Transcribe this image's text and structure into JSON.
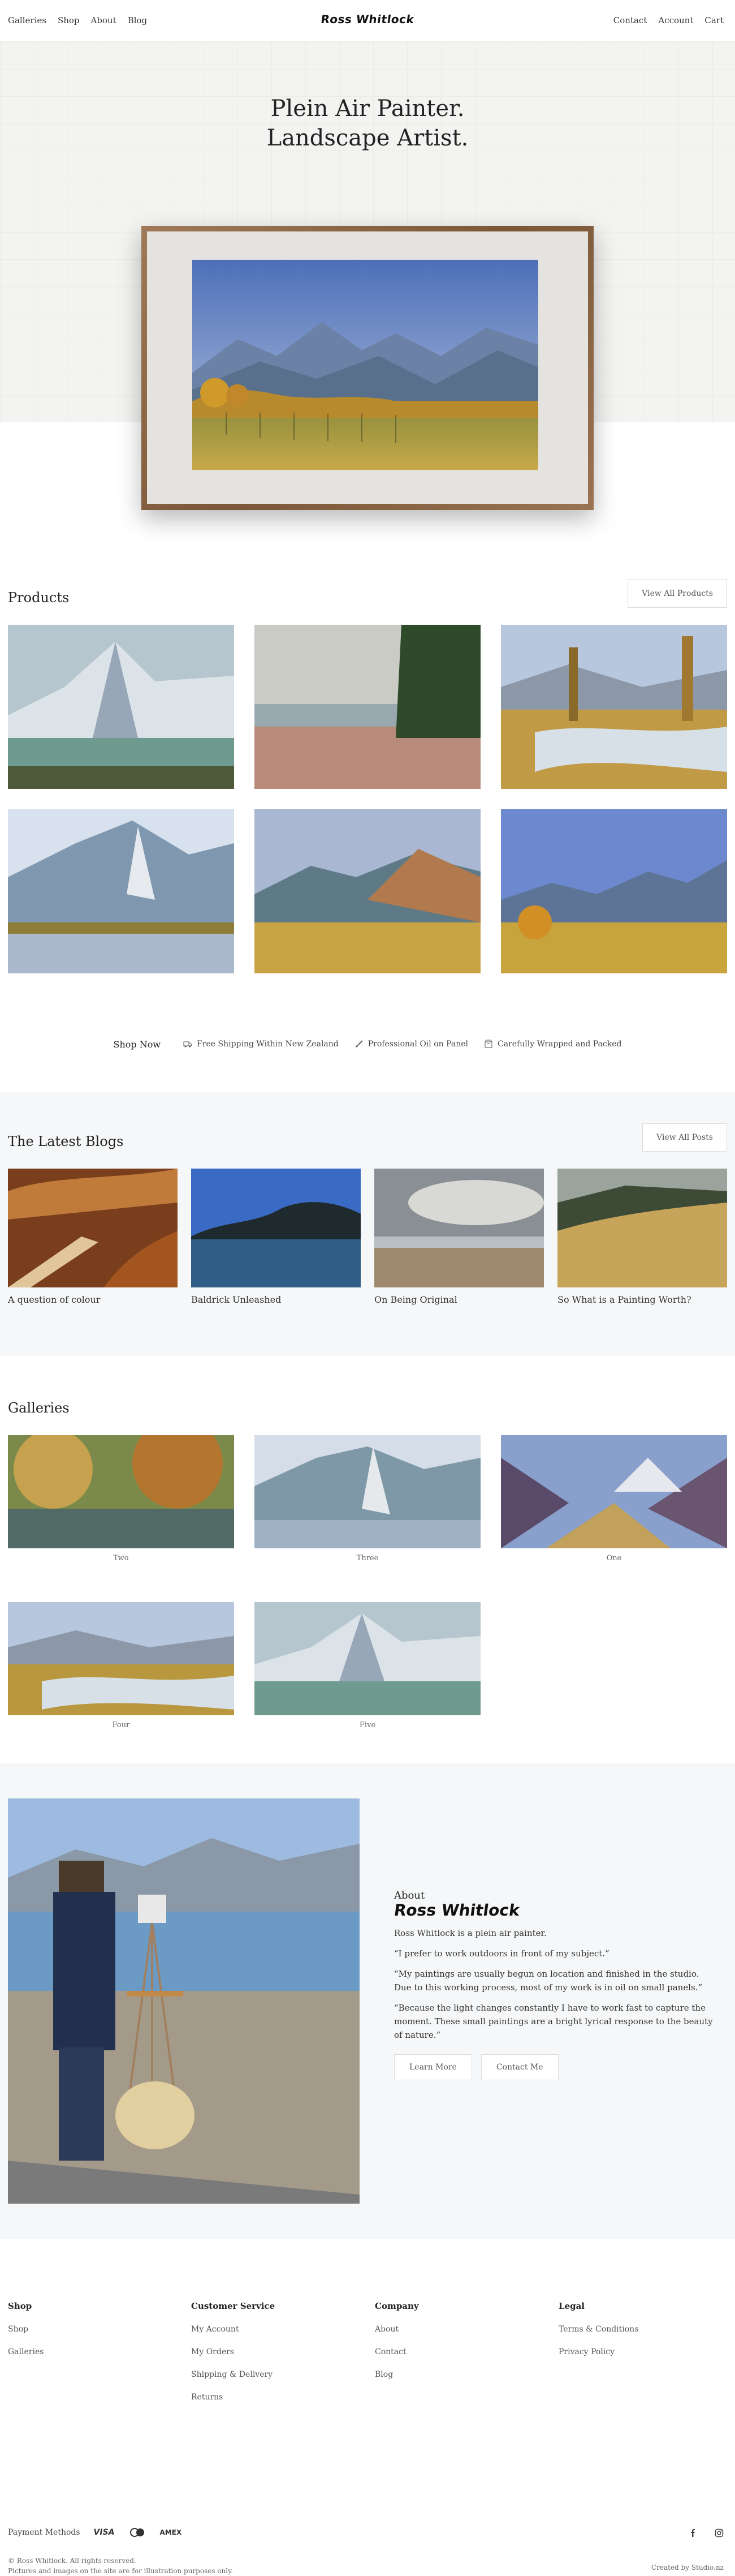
{
  "header": {
    "nav_left": [
      "Galleries",
      "Shop",
      "About",
      "Blog"
    ],
    "logo": "Ross Whitlock",
    "nav_right": [
      "Contact",
      "Account",
      "Cart"
    ]
  },
  "hero": {
    "title_line1": "Plein Air Painter.",
    "title_line2": "Landscape Artist."
  },
  "products": {
    "title": "Products",
    "view_all": "View All Products"
  },
  "shopbar": {
    "lead": "Shop Now",
    "items": [
      "Free Shipping Within New Zealand",
      "Professional Oil on Panel",
      "Carefully Wrapped and Packed"
    ]
  },
  "blogs": {
    "title": "The Latest Blogs",
    "view_all": "View All Posts",
    "posts": [
      "A question of colour",
      "Baldrick Unleashed",
      "On Being Original",
      "So What is a Painting Worth?"
    ]
  },
  "galleries": {
    "title": "Galleries",
    "items": [
      "Two",
      "Three",
      "One",
      "Four",
      "Five"
    ]
  },
  "about": {
    "label": "About",
    "logo": "Ross Whitlock",
    "p1": "Ross Whitlock is a plein air painter.",
    "p2": "“I prefer to work outdoors in front of my subject.”",
    "p3": "“My paintings are usually begun on location and finished in the studio. Due to this working process, most of my work is in oil on small panels.”",
    "p4": "“Because the light changes constantly I have to work fast to capture the moment. These small paintings are a bright lyrical response to the beauty of nature.”",
    "learn_more": "Learn More",
    "contact_me": "Contact Me"
  },
  "footer": {
    "shop": {
      "title": "Shop",
      "links": [
        "Shop",
        "Galleries"
      ]
    },
    "customer": {
      "title": "Customer Service",
      "links": [
        "My Account",
        "My Orders",
        "Shipping & Delivery",
        "Returns"
      ]
    },
    "company": {
      "title": "Company",
      "links": [
        "About",
        "Contact",
        "Blog"
      ]
    },
    "legal": {
      "title": "Legal",
      "links": [
        "Terms & Conditions",
        "Privacy Policy"
      ]
    },
    "payment_label": "Payment Methods",
    "payment_visa": "VISA",
    "payment_amex": "AMEX",
    "copyright1": "© Ross Whitlock. All rights reserved.",
    "copyright2": "Pictures and images on the site are for illustration purposes only.",
    "created_by": "Created by Studio.nz"
  }
}
